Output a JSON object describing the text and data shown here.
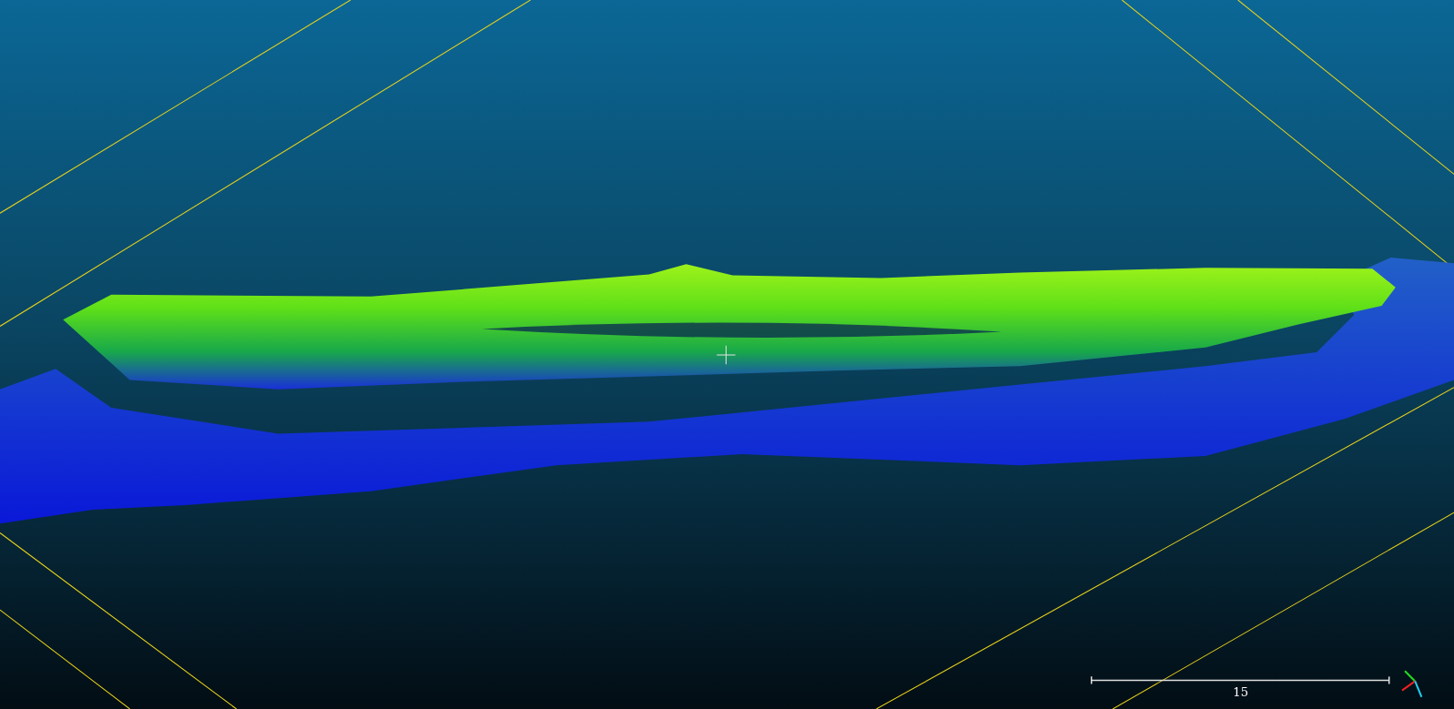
{
  "viewer": {
    "scale_bar": {
      "label": "15"
    }
  }
}
